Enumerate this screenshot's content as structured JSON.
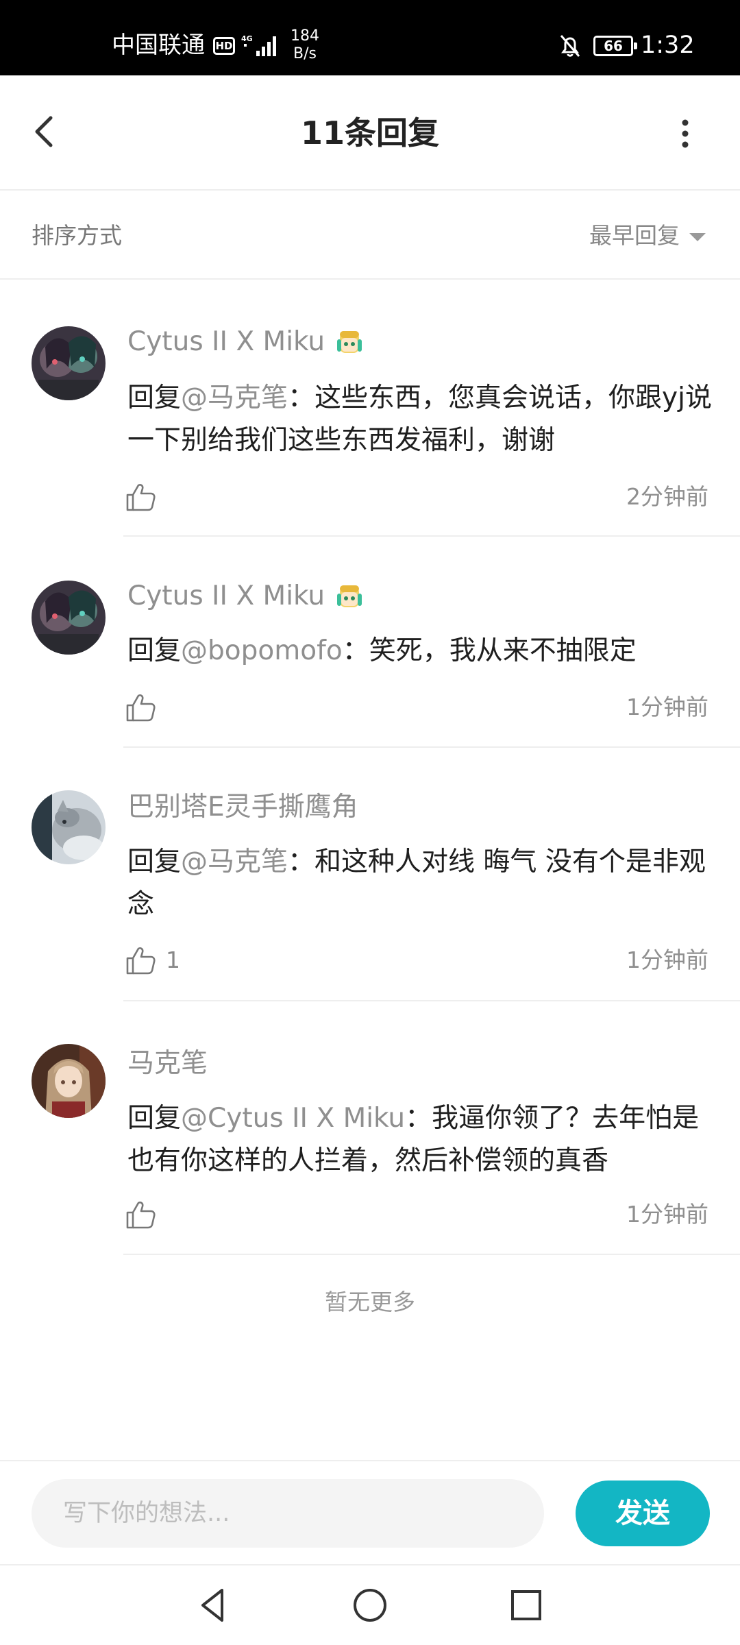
{
  "status_bar": {
    "carrier": "中国联通",
    "hd": "HD",
    "network": "4G",
    "speed_value": "184",
    "speed_unit": "B/s",
    "battery": "66",
    "time": "1:32"
  },
  "header": {
    "title": "11条回复",
    "back_icon": "chevron-left-icon",
    "more_icon": "more-vertical-icon"
  },
  "sort": {
    "label": "排序方式",
    "value": "最早回复"
  },
  "replies": [
    {
      "username": "Cytus II X Miku",
      "has_badge": true,
      "reply_prefix": "回复",
      "mention": "@马克笔",
      "text": "：这些东西，您真会说话，你跟yj说一下别给我们这些东西发福利，谢谢",
      "likes": "",
      "time": "2分钟前"
    },
    {
      "username": "Cytus II X Miku",
      "has_badge": true,
      "reply_prefix": "回复",
      "mention": "@bopomofo",
      "text": "：笑死，我从来不抽限定",
      "likes": "",
      "time": "1分钟前"
    },
    {
      "username": "巴别塔E灵手撕鹰角",
      "has_badge": false,
      "reply_prefix": "回复",
      "mention": "@马克笔",
      "text": "：和这种人对线  晦气  没有个是非观念",
      "likes": "1",
      "time": "1分钟前"
    },
    {
      "username": "马克笔",
      "has_badge": false,
      "reply_prefix": "回复",
      "mention": "@Cytus II X Miku",
      "text": "：我逼你领了？去年怕是也有你这样的人拦着，然后补偿领的真香",
      "likes": "",
      "time": "1分钟前"
    }
  ],
  "footer_text": "暂无更多",
  "input": {
    "placeholder": "写下你的想法...",
    "value": "",
    "send_label": "发送"
  },
  "colors": {
    "accent": "#13b6c4",
    "muted_text": "#8f8f8f",
    "divider": "#eeeeee"
  }
}
